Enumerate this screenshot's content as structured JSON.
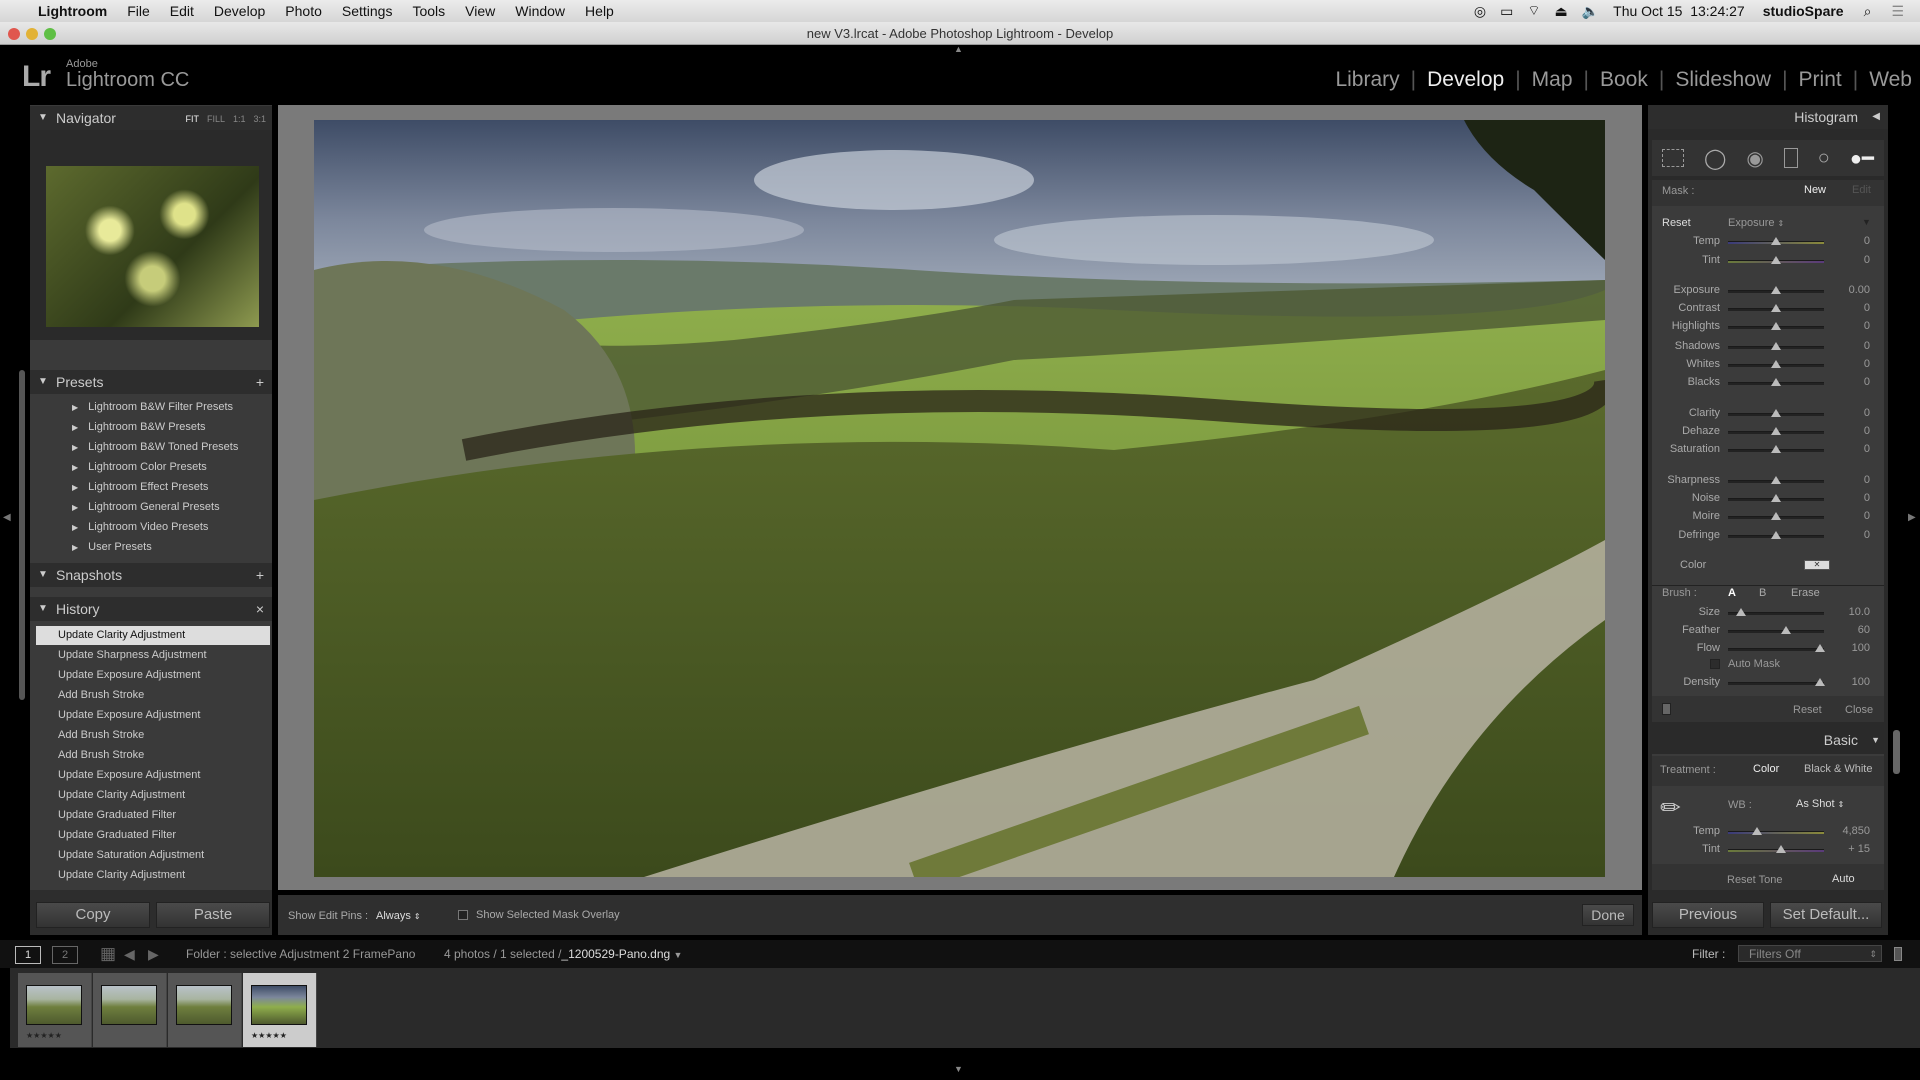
{
  "menubar": {
    "app": "Lightroom",
    "items": [
      "File",
      "Edit",
      "Develop",
      "Photo",
      "Settings",
      "Tools",
      "View",
      "Window",
      "Help"
    ],
    "clock": "Thu Oct 15  13:24:27",
    "user": "studioSpare"
  },
  "window": {
    "title": "new V3.lrcat - Adobe Photoshop Lightroom - Develop"
  },
  "logo": {
    "mark": "Lr",
    "adobe": "Adobe",
    "name": "Lightroom CC"
  },
  "modules": {
    "items": [
      "Library",
      "Develop",
      "Map",
      "Book",
      "Slideshow",
      "Print",
      "Web"
    ],
    "active": "Develop"
  },
  "left": {
    "navigator": {
      "title": "Navigator",
      "zoom": [
        "FIT",
        "FILL",
        "1:1",
        "3:1"
      ]
    },
    "presets": {
      "title": "Presets",
      "items": [
        "Lightroom B&W Filter Presets",
        "Lightroom B&W Presets",
        "Lightroom B&W Toned Presets",
        "Lightroom Color Presets",
        "Lightroom Effect Presets",
        "Lightroom General Presets",
        "Lightroom Video Presets",
        "User Presets"
      ]
    },
    "snapshots": {
      "title": "Snapshots"
    },
    "history": {
      "title": "History",
      "items": [
        "Update Clarity Adjustment",
        "Update Sharpness Adjustment",
        "Update Exposure Adjustment",
        "Add Brush Stroke",
        "Update Exposure Adjustment",
        "Add Brush Stroke",
        "Add Brush Stroke",
        "Update Exposure Adjustment",
        "Update Clarity Adjustment",
        "Update Graduated Filter",
        "Update Graduated Filter",
        "Update Saturation Adjustment",
        "Update Clarity Adjustment"
      ]
    },
    "copy": "Copy",
    "paste": "Paste"
  },
  "toolbar": {
    "pins_label": "Show Edit Pins :",
    "pins_value": "Always",
    "overlay_label": "Show Selected Mask Overlay",
    "done": "Done"
  },
  "right": {
    "histogram": "Histogram",
    "mask": {
      "label": "Mask :",
      "new": "New",
      "edit": "Edit"
    },
    "reset": "Reset",
    "effect": "Exposure",
    "sliders": [
      {
        "label": "Temp",
        "value": "0",
        "pos": 0.5
      },
      {
        "label": "Tint",
        "value": "0",
        "pos": 0.5
      },
      {
        "label": "Exposure",
        "value": "0.00",
        "pos": 0.5
      },
      {
        "label": "Contrast",
        "value": "0",
        "pos": 0.5
      },
      {
        "label": "Highlights",
        "value": "0",
        "pos": 0.5
      },
      {
        "label": "Shadows",
        "value": "0",
        "pos": 0.5
      },
      {
        "label": "Whites",
        "value": "0",
        "pos": 0.5
      },
      {
        "label": "Blacks",
        "value": "0",
        "pos": 0.5
      },
      {
        "label": "Clarity",
        "value": "0",
        "pos": 0.5
      },
      {
        "label": "Dehaze",
        "value": "0",
        "pos": 0.5
      },
      {
        "label": "Saturation",
        "value": "0",
        "pos": 0.5
      },
      {
        "label": "Sharpness",
        "value": "0",
        "pos": 0.5
      },
      {
        "label": "Noise",
        "value": "0",
        "pos": 0.5
      },
      {
        "label": "Moire",
        "value": "0",
        "pos": 0.5
      },
      {
        "label": "Defringe",
        "value": "0",
        "pos": 0.5
      }
    ],
    "color_label": "Color",
    "brush": {
      "label": "Brush :",
      "a": "A",
      "b": "B",
      "erase": "Erase",
      "sliders": [
        {
          "label": "Size",
          "value": "10.0",
          "pos": 0.14
        },
        {
          "label": "Feather",
          "value": "60",
          "pos": 0.6
        },
        {
          "label": "Flow",
          "value": "100",
          "pos": 0.96
        }
      ],
      "automask": "Auto Mask",
      "density": {
        "label": "Density",
        "value": "100",
        "pos": 0.96
      },
      "reset": "Reset",
      "close": "Close"
    },
    "basic": {
      "title": "Basic",
      "treatment": "Treatment :",
      "color": "Color",
      "bw": "Black & White",
      "wb": "WB :",
      "wb_value": "As Shot",
      "sliders": [
        {
          "label": "Temp",
          "value": "4,850",
          "pos": 0.3
        },
        {
          "label": "Tint",
          "value": "+ 15",
          "pos": 0.55
        }
      ],
      "reset_tone": "Reset Tone",
      "auto": "Auto"
    },
    "previous": "Previous",
    "set_default": "Set Default..."
  },
  "filmstrip": {
    "pages": [
      "1",
      "2"
    ],
    "folder": "Folder : selective Adjustment 2 FramePano",
    "count": "4 photos / 1 selected /",
    "file": "_1200529-Pano.dng",
    "filter_label": "Filter :",
    "filter_value": "Filters Off",
    "thumbs": [
      {
        "stars": "★★★★★",
        "selected": false
      },
      {
        "stars": "",
        "selected": false
      },
      {
        "stars": "",
        "selected": false
      },
      {
        "stars": "★★★★★",
        "selected": true
      }
    ]
  }
}
